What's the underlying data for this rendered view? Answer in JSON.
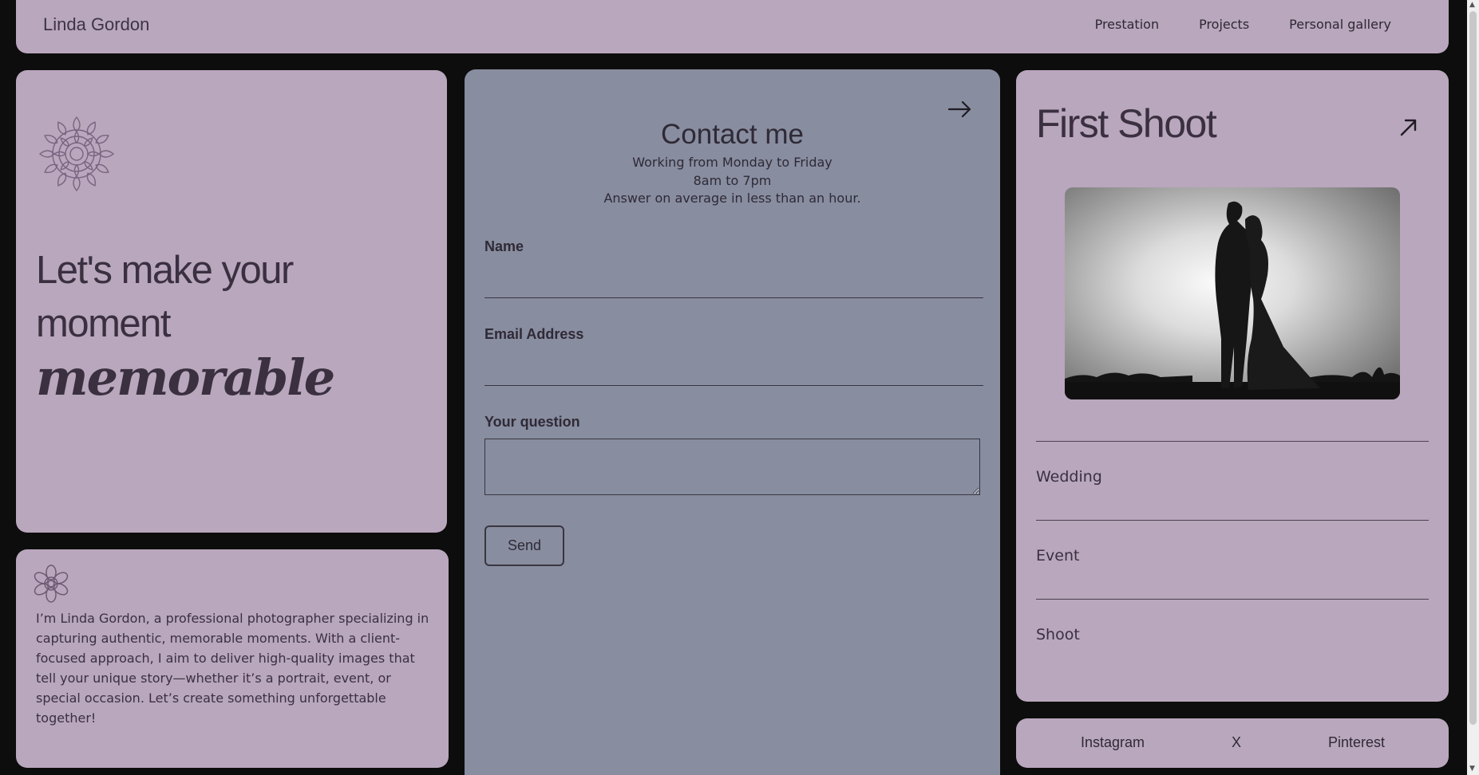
{
  "header": {
    "brand": "Linda Gordon",
    "nav": [
      "Prestation",
      "Projects",
      "Personal gallery"
    ]
  },
  "hero": {
    "line1": "Let's make your",
    "line2": "moment",
    "script": "memorable"
  },
  "bio": {
    "text": "I’m Linda Gordon, a professional photographer specializing in capturing authentic, memorable moments. With a client-focused approach, I aim to deliver high-quality images that tell your unique story—whether it’s a portrait, event, or special occasion. Let’s create something unforgettable together!"
  },
  "contact": {
    "title": "Contact me",
    "hours_line1": "Working from Monday to Friday",
    "hours_line2": "8am to 7pm",
    "hours_line3": "Answer on average in less than an hour.",
    "name_label": "Name",
    "email_label": "Email Address",
    "question_label": "Your question",
    "send_label": "Send"
  },
  "shoot": {
    "title": "First Shoot",
    "categories": [
      "Wedding",
      "Event",
      "Shoot"
    ]
  },
  "social": {
    "links": [
      "Instagram",
      "X",
      "Pinterest"
    ]
  },
  "colors": {
    "page_bg": "#0d0d0d",
    "card_bg": "#b9a7bd",
    "contact_bg": "#888da0",
    "text": "#3a3040"
  }
}
